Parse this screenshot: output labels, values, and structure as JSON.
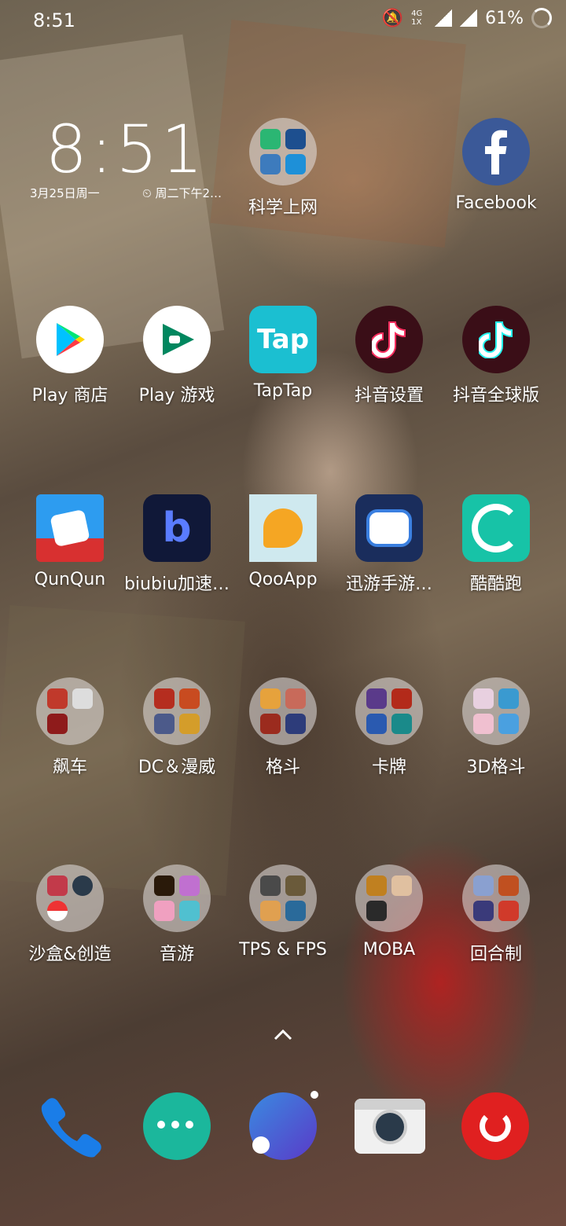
{
  "status_bar": {
    "time": "8:51",
    "network": "4G 1X",
    "battery": "61%"
  },
  "clock_widget": {
    "time": "8:51",
    "date": "3月25日周一",
    "alarm": "周二下午2…"
  },
  "home_rows": [
    [
      {
        "label": "科学上网",
        "type": "folder"
      },
      {
        "label": "Facebook",
        "type": "app"
      }
    ],
    [
      {
        "label": "Play 商店"
      },
      {
        "label": "Play 游戏"
      },
      {
        "label": "TapTap"
      },
      {
        "label": "抖音设置"
      },
      {
        "label": "抖音全球版"
      }
    ],
    [
      {
        "label": "QunQun"
      },
      {
        "label": "biubiu加速…"
      },
      {
        "label": "QooApp"
      },
      {
        "label": "迅游手游…"
      },
      {
        "label": "酷酷跑"
      }
    ],
    [
      {
        "label": "飙车"
      },
      {
        "label": "DC＆漫威"
      },
      {
        "label": "格斗"
      },
      {
        "label": "卡牌"
      },
      {
        "label": "3D格斗"
      }
    ],
    [
      {
        "label": "沙盒&创造"
      },
      {
        "label": "音游"
      },
      {
        "label": "TPS & FPS"
      },
      {
        "label": "MOBA"
      },
      {
        "label": "回合制"
      }
    ]
  ],
  "dock": [
    "phone",
    "messages",
    "oneplus-launcher",
    "camera",
    "netease-music"
  ],
  "colors": {
    "tap_teal": "#1bbfd1",
    "tiktok_bg": "#3a0e17",
    "netease_red": "#e02020",
    "fb_blue": "#3b5998"
  }
}
